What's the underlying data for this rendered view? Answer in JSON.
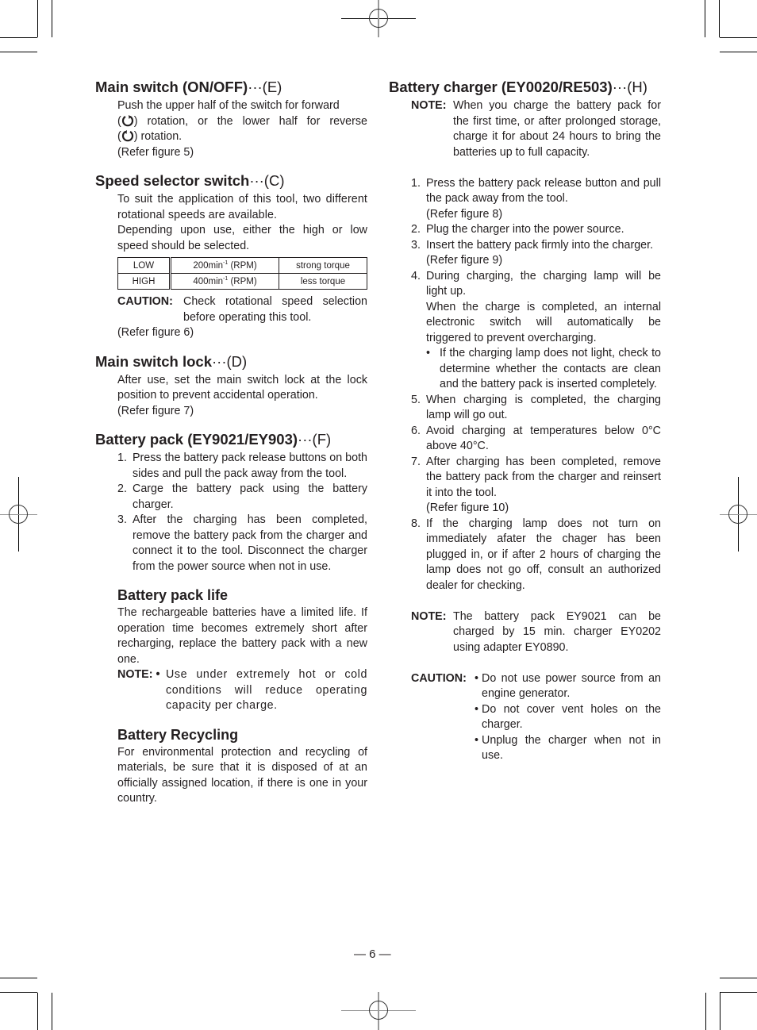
{
  "left": {
    "main_switch": {
      "title": "Main switch (ON/OFF)",
      "suffix": "···(E)",
      "line1": "Push the upper half of the switch for forward",
      "line2a": "(",
      "line2b": ") rotation, or the lower half for reverse",
      "line3a": "(",
      "line3b": ") rotation.",
      "forward_icon": "clockwise-arrow-icon",
      "reverse_icon": "counterclockwise-arrow-icon",
      "ref": "(Refer figure 5)"
    },
    "speed_selector": {
      "title": "Speed selector switch",
      "suffix": "···(C)",
      "para1": "To suit the application of this tool, two different rotational speeds are available.",
      "para2": "Depending upon use, either the high or low speed should be selected.",
      "table": [
        {
          "mode": "LOW",
          "speed": "200min",
          "exp": "-1",
          "unit": " (RPM)",
          "torque": "strong torque"
        },
        {
          "mode": "HIGH",
          "speed": "400min",
          "exp": "-1",
          "unit": " (RPM)",
          "torque": "less torque"
        }
      ],
      "caution_label": "CAUTION:",
      "caution_text": "Check rotational speed selection before operating this tool.",
      "ref": "(Refer figure 6)"
    },
    "switch_lock": {
      "title": "Main switch lock",
      "suffix": "···(D)",
      "para": "After use, set the main switch lock at the lock position to prevent accidental operation.",
      "ref": "(Refer figure 7)"
    },
    "battery_pack": {
      "title": "Battery pack (EY9021/EY903)",
      "suffix": "···(F)",
      "items": [
        {
          "n": "1.",
          "text": "Press the battery pack release buttons on both sides and pull the pack away from the tool."
        },
        {
          "n": "2.",
          "text": "Carge the battery pack using the battery charger."
        },
        {
          "n": "3.",
          "text": "After the charging has been completed, remove the battery pack from the charger and connect it to the tool. Disconnect the charger from the power source when not in use."
        }
      ]
    },
    "pack_life": {
      "title": "Battery pack life",
      "para": "The rechargeable batteries have a limited life. If operation time becomes extremely short after recharging, replace the battery pack with a new one.",
      "note_label": "NOTE: •",
      "note_text": "Use under extremely hot or cold conditions will reduce operating capacity per charge."
    },
    "recycling": {
      "title": "Battery Recycling",
      "para": "For environmental protection and recycling of materials, be sure that it is disposed of at an officially assigned location, if there is one in your country."
    }
  },
  "right": {
    "charger": {
      "title": "Battery charger (EY0020/RE503)",
      "suffix": "···(H)",
      "note_label": "NOTE:",
      "note_text": "When you charge the battery pack for the first time, or after prolonged storage, charge it for about 24 hours to bring the batteries up to full capacity.",
      "items": [
        {
          "n": "1.",
          "text": "Press the battery pack release button and pull the pack away from the tool.",
          "ref": "(Refer figure 8)"
        },
        {
          "n": "2.",
          "text": "Plug the charger into the power source."
        },
        {
          "n": "3.",
          "text": "Insert the battery pack firmly into the charger.",
          "ref": "(Refer figure 9)"
        },
        {
          "n": "4.",
          "text": "During charging, the charging lamp will be light up.",
          "extra": "When the charge is completed, an internal electronic switch will automatically be triggered to prevent overcharging.",
          "bullet": "If the charging lamp does not light, check to determine whether the contacts are clean and the battery pack is inserted completely."
        },
        {
          "n": "5.",
          "text": "When charging is completed, the charging lamp will go out."
        },
        {
          "n": "6.",
          "text": "Avoid charging at temperatures below 0°C above 40°C."
        },
        {
          "n": "7.",
          "text": "After charging has been completed, remove the battery pack from the charger and reinsert it into the tool.",
          "ref": "(Refer figure 10)"
        },
        {
          "n": "8.",
          "text": "If the charging lamp does not turn on immediately afater the chager has been plugged in, or if after 2 hours of charging the lamp does not go off, consult an authorized dealer for checking."
        }
      ],
      "note2_label": "NOTE:",
      "note2_text": "The battery pack EY9021 can be charged by 15 min. charger EY0202 using adapter EY0890.",
      "caution_label": "CAUTION:",
      "cautions": [
        "Do not use power source from an engine generator.",
        "Do not cover vent holes on the charger.",
        "Unplug the charger when not in use."
      ]
    }
  },
  "footer": {
    "page_number": "— 6 —"
  }
}
